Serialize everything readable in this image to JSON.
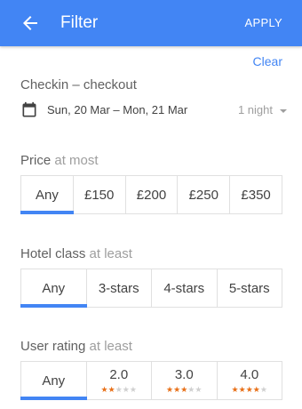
{
  "appbar": {
    "title": "Filter",
    "apply_label": "APPLY"
  },
  "clear_label": "Clear",
  "checkin": {
    "title": "Checkin – checkout",
    "dates": "Sun, 20 Mar – Mon, 21 Mar",
    "nights": "1 night"
  },
  "price": {
    "title": "Price",
    "qualifier": "at most",
    "options": [
      "Any",
      "£150",
      "£200",
      "£250",
      "£350"
    ],
    "selected": 0
  },
  "hotel_class": {
    "title": "Hotel class",
    "qualifier": "at least",
    "options": [
      "Any",
      "3-stars",
      "4-stars",
      "5-stars"
    ],
    "selected": 0
  },
  "user_rating": {
    "title": "User rating",
    "qualifier": "at least",
    "options": [
      {
        "label": "Any"
      },
      {
        "label": "2.0",
        "stars_on": 2,
        "stars_total": 5
      },
      {
        "label": "3.0",
        "stars_on": 3,
        "stars_total": 5
      },
      {
        "label": "4.0",
        "stars_on": 4,
        "stars_total": 5
      }
    ],
    "selected": 0
  },
  "colors": {
    "accent": "#4285f4",
    "star": "#e8711a"
  },
  "icons": {
    "back": "arrow-left-icon",
    "calendar": "calendar-icon",
    "dropdown": "caret-down-icon"
  }
}
